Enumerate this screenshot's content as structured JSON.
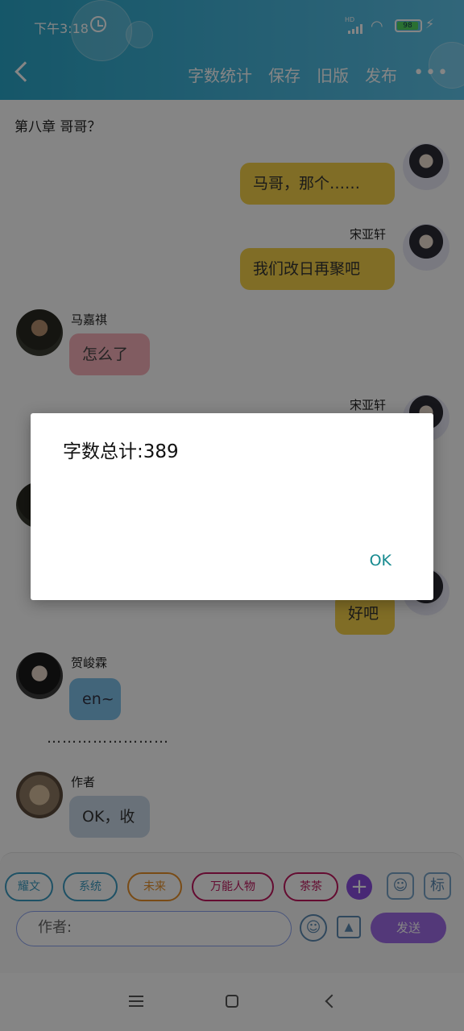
{
  "status_bar": {
    "time": "下午3:18",
    "hd": "HD",
    "battery": "98"
  },
  "header": {
    "actions": [
      "字数统计",
      "保存",
      "旧版",
      "发布"
    ],
    "more": "•••"
  },
  "chapter_title": "第八章 哥哥？",
  "messages": [
    {
      "name": "",
      "text": "马哥，那个……"
    },
    {
      "name": "宋亚轩",
      "text": "我们改日再聚吧"
    },
    {
      "name": "马嘉祺",
      "text": "怎么了"
    },
    {
      "name": "宋亚轩",
      "text": ""
    },
    {
      "name": "",
      "text": "好吧"
    },
    {
      "name": "贺峻霖",
      "text": "en~"
    },
    {
      "name": "作者",
      "text": "OK，收"
    }
  ],
  "separator": "……………………",
  "composer": {
    "chips": [
      "耀文",
      "系统",
      "未来",
      "万能人物",
      "茶茶"
    ],
    "plus": "+",
    "person_icon": "person-icon",
    "tag_label": "标",
    "author_placeholder": "作者:",
    "send_label": "发送"
  },
  "dialog": {
    "message": "字数总计:389",
    "ok_label": "OK"
  }
}
